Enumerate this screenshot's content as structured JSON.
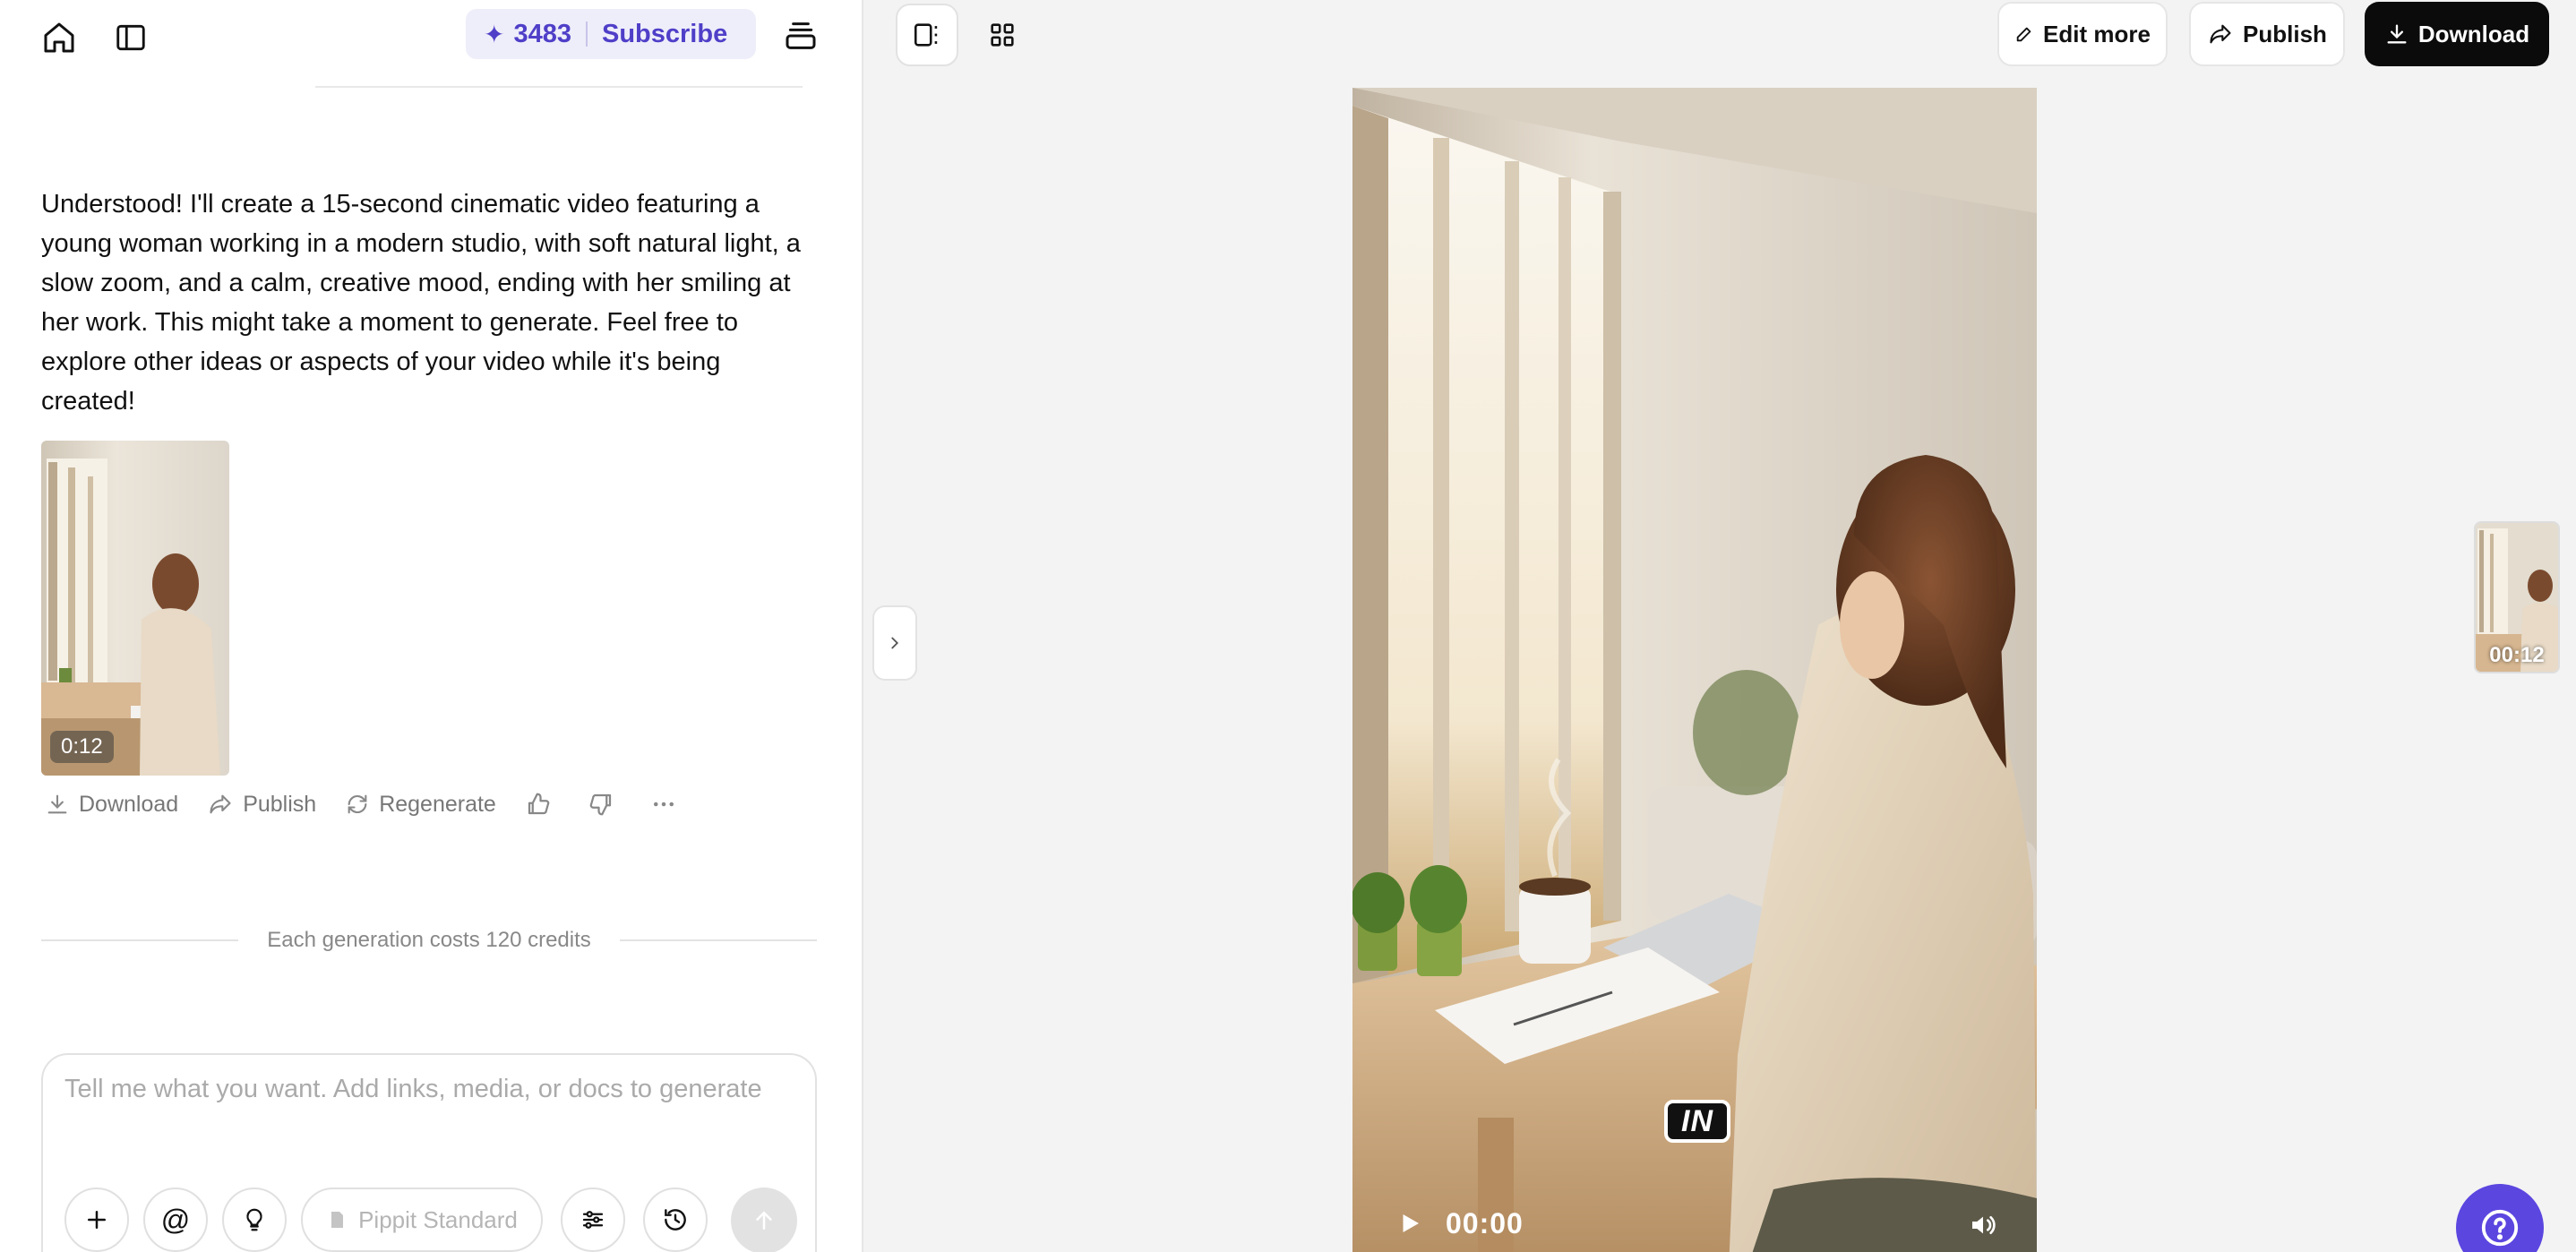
{
  "header": {
    "credits": "3483",
    "subscribe_label": "Subscribe"
  },
  "chat": {
    "assistant_message": "Understood! I'll create a 15-second cinematic video featuring a young woman working in a modern studio, with soft natural light, a slow zoom, and a calm, creative mood, ending with her smiling at her work. This might take a moment to generate. Feel free to explore other ideas or aspects of your video while it's being created!",
    "thumbnail_duration": "0:12",
    "actions": {
      "download": "Download",
      "publish": "Publish",
      "regenerate": "Regenerate"
    },
    "cost_note": "Each generation costs 120 credits"
  },
  "composer": {
    "placeholder": "Tell me what you want. Add links, media, or docs to generate",
    "value": "",
    "model_label": "Pippit Standard"
  },
  "toolbar": {
    "edit_more": "Edit more",
    "publish": "Publish",
    "download": "Download"
  },
  "player": {
    "overlay_logo": "IN",
    "time": "00:00",
    "side_thumb_duration": "00:12"
  },
  "colors": {
    "accent": "#5b46e0",
    "credits_text": "#4f3fc8",
    "download_bg": "#0b0b0b"
  }
}
